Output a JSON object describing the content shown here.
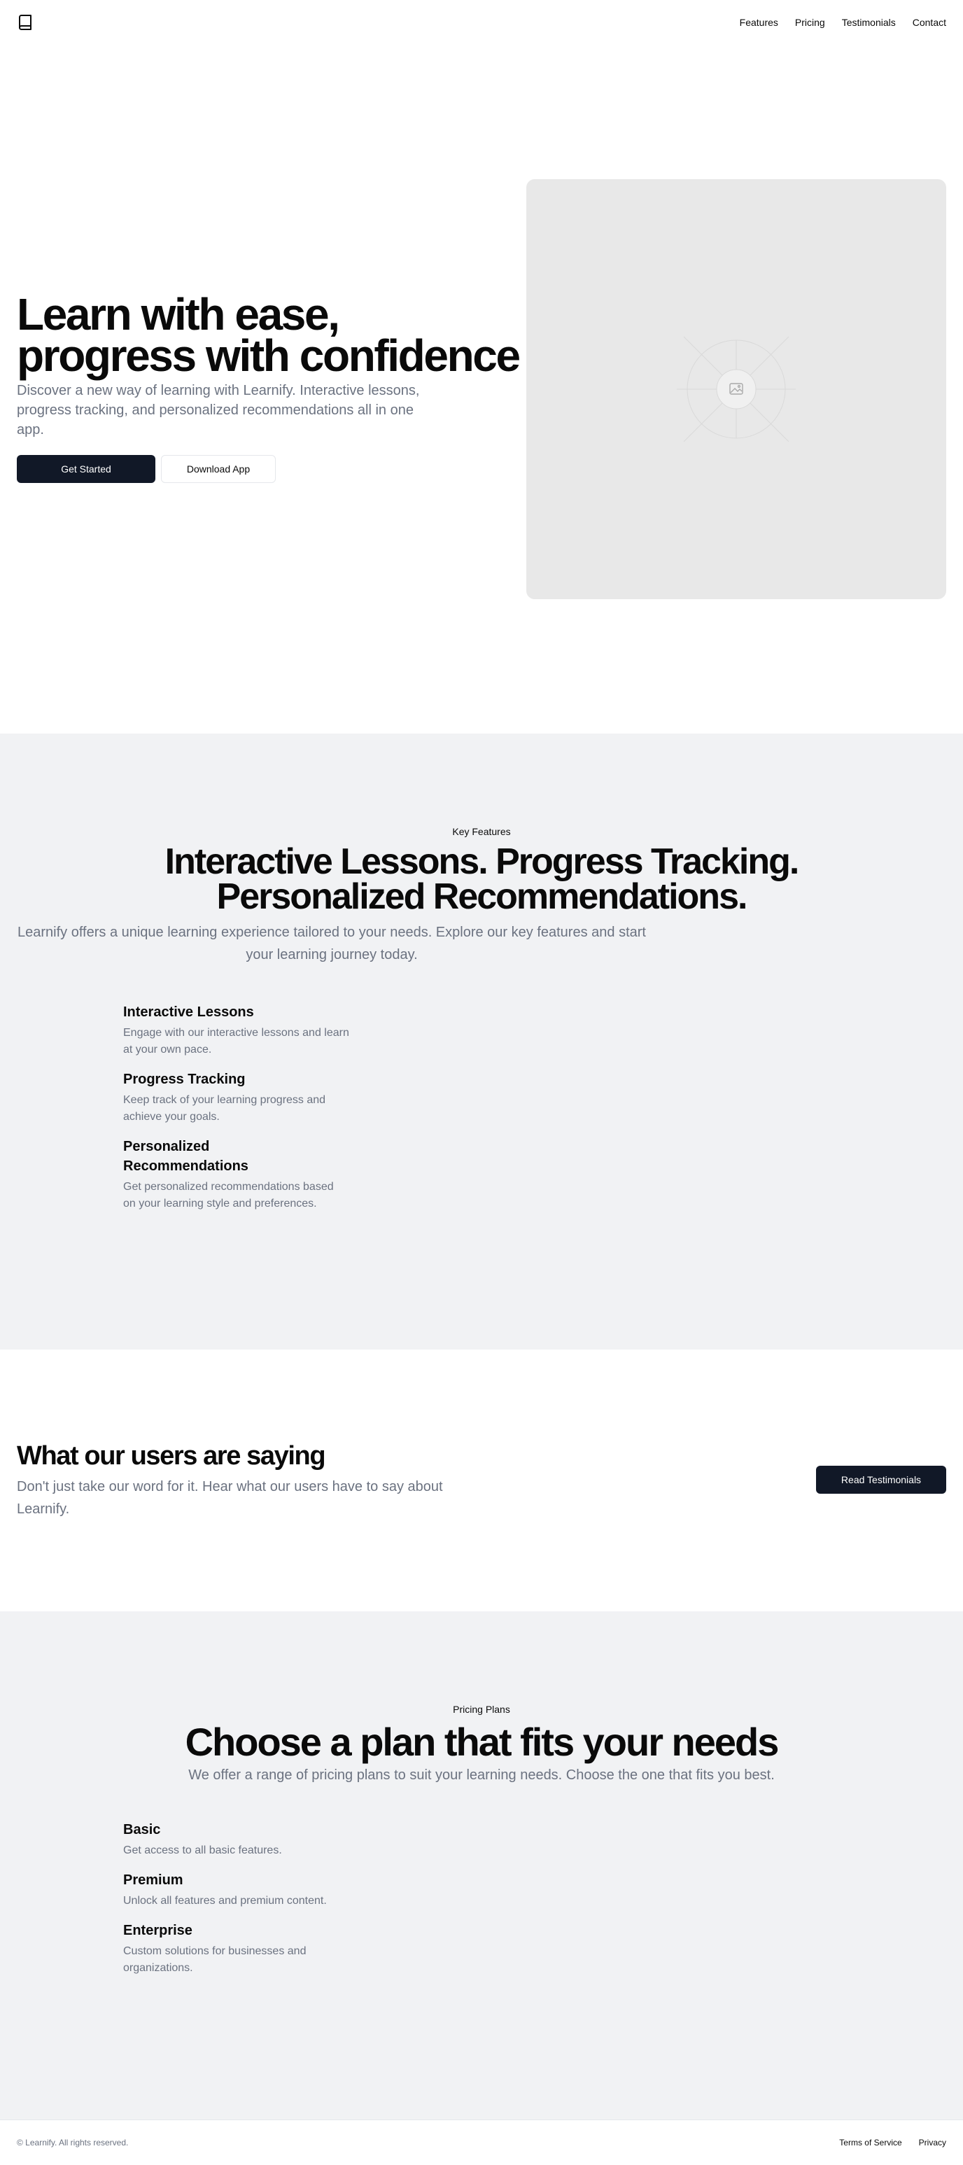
{
  "header": {
    "logo_icon": "book-icon",
    "nav": [
      "Features",
      "Pricing",
      "Testimonials",
      "Contact"
    ]
  },
  "hero": {
    "title_line1": "Learn with ease,",
    "title_line2": "progress with confidence",
    "subtitle": "Discover a new way of learning with Learnify. Interactive lessons, progress tracking, and personalized recommendations all in one app.",
    "primary_button": "Get Started",
    "secondary_button": "Download App",
    "image_icon": "image-placeholder-icon"
  },
  "features": {
    "eyebrow": "Key Features",
    "title": "Interactive Lessons. Progress Tracking. Personalized Recommendations.",
    "subtitle": "Learnify offers a unique learning experience tailored to your needs. Explore our key features and start your learning journey today.",
    "items": [
      {
        "title": "Interactive Lessons",
        "description": "Engage with our interactive lessons and learn at your own pace."
      },
      {
        "title": "Progress Tracking",
        "description": "Keep track of your learning progress and achieve your goals."
      },
      {
        "title": "Personalized Recommendations",
        "description": "Get personalized recommendations based on your learning style and preferences."
      }
    ]
  },
  "testimonials": {
    "title": "What our users are saying",
    "subtitle": "Don't just take our word for it. Hear what our users have to say about Learnify.",
    "button": "Read Testimonials"
  },
  "pricing": {
    "eyebrow": "Pricing Plans",
    "title": "Choose a plan that fits your needs",
    "subtitle": "We offer a range of pricing plans to suit your learning needs. Choose the one that fits you best.",
    "plans": [
      {
        "title": "Basic",
        "description": "Get access to all basic features."
      },
      {
        "title": "Premium",
        "description": "Unlock all features and premium content."
      },
      {
        "title": "Enterprise",
        "description": "Custom solutions for businesses and organizations."
      }
    ]
  },
  "footer": {
    "copyright": "© Learnify. All rights reserved.",
    "links": [
      "Terms of Service",
      "Privacy"
    ]
  },
  "colors": {
    "primary": "#111827",
    "muted_text": "#6b7280",
    "section_bg": "#f1f2f4"
  }
}
